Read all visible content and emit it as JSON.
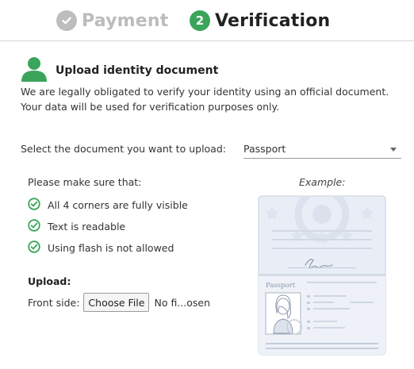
{
  "steps": [
    {
      "label": "Payment",
      "state": "completed",
      "icon": "check-icon",
      "color": "#bdbdbd"
    },
    {
      "label": "Verification",
      "number": "2",
      "state": "active",
      "color": "#3aa55a"
    }
  ],
  "upload_section": {
    "icon": "user-icon",
    "title": "Upload identity document",
    "description": "We are legally obligated to verify your identity using an official document. Your data will be used for verification purposes only."
  },
  "document_select": {
    "label": "Select the document you want to upload:",
    "value": "Passport"
  },
  "requirements": {
    "title": "Please make sure that:",
    "items": [
      "All 4 corners are fully visible",
      "Text is readable",
      "Using flash is not allowed"
    ],
    "check_color": "#3aa55a"
  },
  "upload": {
    "title": "Upload:",
    "front_label": "Front side:",
    "button_label": "Choose File",
    "file_status": "No fi...osen"
  },
  "example": {
    "label": "Example:",
    "passport_text": "Passport"
  }
}
